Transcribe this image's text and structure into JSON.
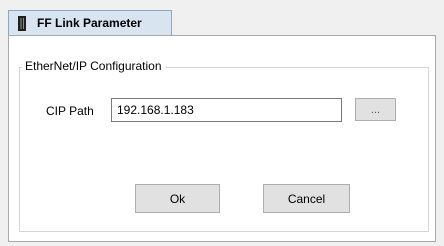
{
  "tab": {
    "label": "FF Link Parameter",
    "icon": "ff-device-icon"
  },
  "group": {
    "title": "EtherNet/IP Configuration"
  },
  "cip_path": {
    "label": "CIP Path",
    "value": "192.168.1.183",
    "browse_label": "..."
  },
  "buttons": {
    "ok_label": "Ok",
    "cancel_label": "Cancel"
  },
  "colors": {
    "tab_background": "#d9e4f1",
    "page_background": "#ffffff",
    "window_background": "#f0f0f0",
    "button_background": "#e1e1e1"
  }
}
